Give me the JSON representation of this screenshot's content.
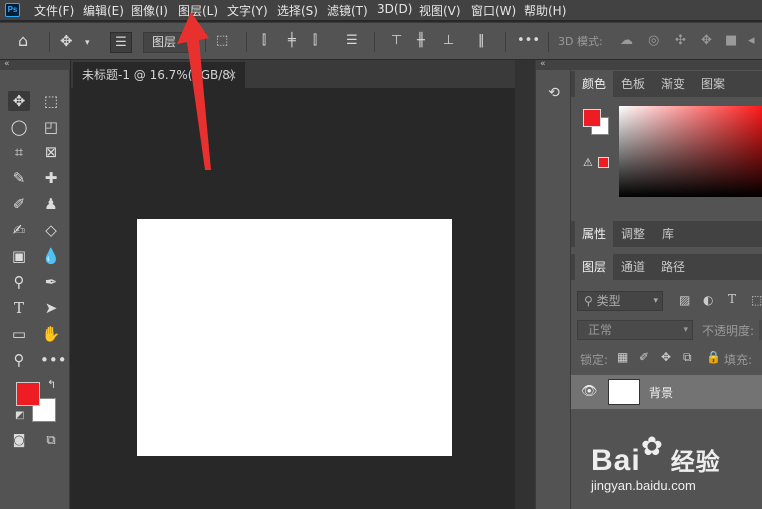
{
  "menubar": {
    "logo": "Ps",
    "items": [
      "文件(F)",
      "编辑(E)",
      "图像(I)",
      "图层(L)",
      "文字(Y)",
      "选择(S)",
      "滤镜(T)",
      "3D(D)",
      "视图(V)",
      "窗口(W)",
      "帮助(H)"
    ]
  },
  "options": {
    "layer_select": "图层",
    "mode_3d_label": "3D 模式:",
    "more": "•••"
  },
  "toolbar": {
    "collapse": "«"
  },
  "document": {
    "tab_title": "未标题-1 @ 16.7%(RGB/8)",
    "close": "×"
  },
  "panels": {
    "collapse": "«",
    "color_tabs": [
      "颜色",
      "色板",
      "渐变",
      "图案"
    ],
    "props_tabs": [
      "属性",
      "调整",
      "库"
    ],
    "layers_tabs": [
      "图层",
      "通道",
      "路径"
    ],
    "filter_kind": "类型",
    "blend_mode": "正常",
    "opacity_label": "不透明度:",
    "lock_label": "锁定:",
    "fill_label": "填充:",
    "layer_name": "背景"
  },
  "colors": {
    "foreground": "#ee1d23",
    "background": "#ffffff",
    "arrow": "#e8312f"
  },
  "watermark": {
    "brand": "Bai",
    "brand_suffix": "经验",
    "url": "jingyan.baidu.com"
  }
}
